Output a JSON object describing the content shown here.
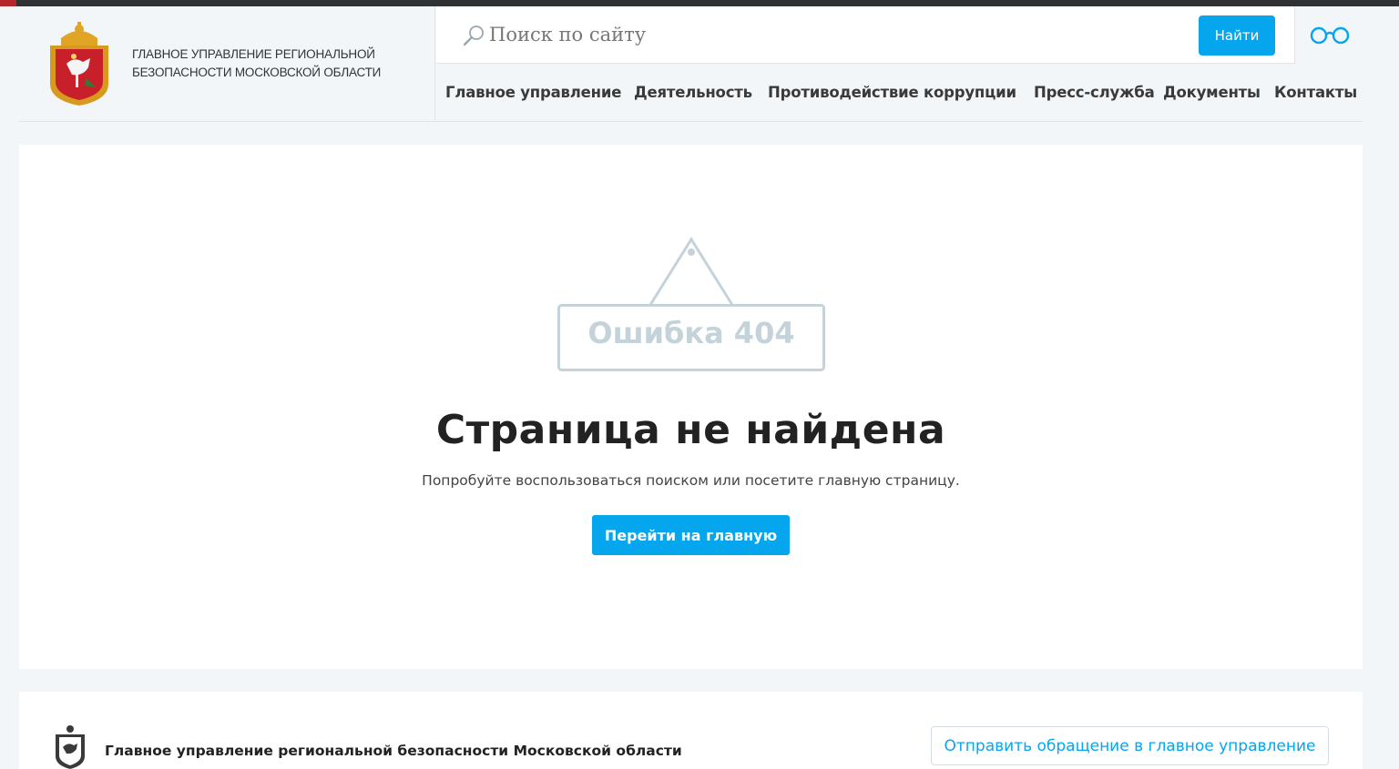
{
  "header": {
    "org_name_line1": "Главное управление региональной",
    "org_name_line2": "безопасности Московской области"
  },
  "search": {
    "placeholder": "Поиск по сайту",
    "button_label": "Найти"
  },
  "nav": {
    "items": [
      {
        "label": "Главное управление"
      },
      {
        "label": "Деятельность"
      },
      {
        "label": "Противодействие коррупции"
      },
      {
        "label": "Пресс-служба"
      },
      {
        "label": "Документы"
      },
      {
        "label": "Контакты"
      }
    ]
  },
  "error": {
    "sign_text": "Ошибка 404",
    "title": "Страница не найдена",
    "subtitle": "Попробуйте воспользоваться поиском или посетите главную страницу.",
    "home_button": "Перейти на главную"
  },
  "footer": {
    "org_name": "Главное управление региональной безопасности Московской области",
    "appeal_button": "Отправить обращение в главное управление"
  },
  "colors": {
    "accent": "#05a6ee",
    "topbar": "#2f3133",
    "topbar_red": "#b3262c",
    "sign_gray": "#c4d2da"
  },
  "icons": {
    "search": "search-icon",
    "visually_impaired": "glasses-icon",
    "coat_of_arms": "coat-of-arms-icon"
  }
}
